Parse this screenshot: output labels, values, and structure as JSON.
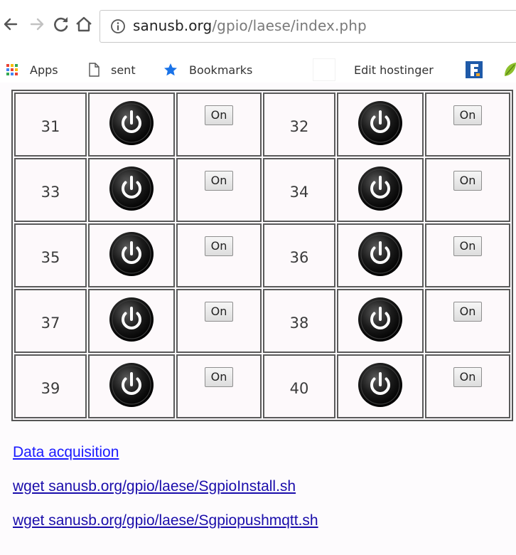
{
  "browser": {
    "url_host": "sanusb.org",
    "url_path": "/gpio/laese/index.php"
  },
  "bookmarks_bar": {
    "items": [
      {
        "label": "Apps",
        "icon": "apps-grid-icon"
      },
      {
        "label": "sent",
        "icon": "page-icon"
      },
      {
        "label": "Bookmarks",
        "icon": "star-icon"
      },
      {
        "label": "Edit hostinger",
        "icon": "blank-favicon-icon"
      },
      {
        "label": "",
        "icon": "f-favicon-icon"
      },
      {
        "label": "",
        "icon": "leaf-favicon-icon"
      }
    ]
  },
  "gpio": {
    "button_label": "On",
    "rows": [
      {
        "left_pin": "31",
        "right_pin": "32"
      },
      {
        "left_pin": "33",
        "right_pin": "34"
      },
      {
        "left_pin": "35",
        "right_pin": "36"
      },
      {
        "left_pin": "37",
        "right_pin": "38"
      },
      {
        "left_pin": "39",
        "right_pin": "40"
      }
    ]
  },
  "links": [
    {
      "text": "Data acquisition"
    },
    {
      "text": "wget sanusb.org/gpio/laese/SgpioInstall.sh"
    },
    {
      "text": "wget sanusb.org/gpio/laese/Sgpiopushmqtt.sh"
    }
  ],
  "colors": {
    "link": "#1a0dab",
    "star": "#1a73e8",
    "apps_grid": [
      "#ea4335",
      "#fbbc05",
      "#34a853",
      "#4285f4"
    ]
  }
}
